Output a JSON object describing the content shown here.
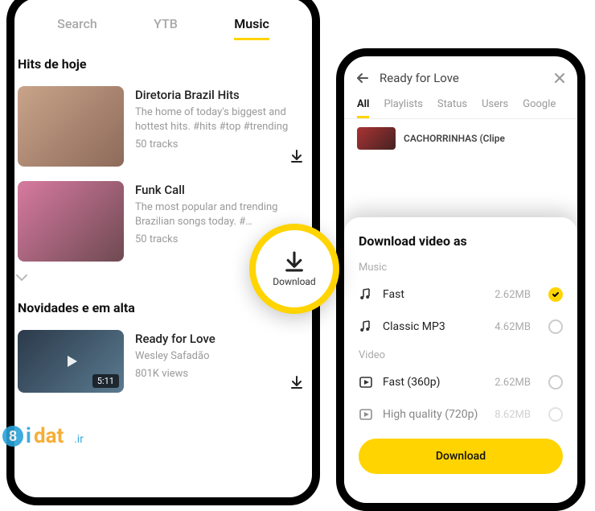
{
  "left": {
    "tabs": [
      "Search",
      "YTB",
      "Music"
    ],
    "activeTabIndex": 2,
    "sections": {
      "hits": {
        "title": "Hits de hoje",
        "items": [
          {
            "title": "Diretoria Brazil Hits",
            "subtitle": "The home of today's biggest and hottest hits. #hits #top #trending",
            "tracks": "50 tracks"
          },
          {
            "title": "Funk Call",
            "subtitle": "The most popular and trending Brazilian songs today. #…",
            "tracks": "50 tracks"
          }
        ]
      },
      "novidades": {
        "title": "Novidades e em alta",
        "items": [
          {
            "title": "Ready for Love",
            "artist": "Wesley Safadão",
            "views": "801K views",
            "duration": "5:11"
          }
        ]
      }
    }
  },
  "floating": {
    "label": "Download"
  },
  "right": {
    "header": {
      "title": "Ready for Love"
    },
    "tabs": [
      "All",
      "Playlists",
      "Status",
      "Users",
      "Google"
    ],
    "activeTabIndex": 0,
    "peekTitle": "CACHORRINHAS (Clipe",
    "sheet": {
      "title": "Download video as",
      "groups": [
        {
          "label": "Music",
          "options": [
            {
              "icon": "music-note-icon",
              "label": "Fast",
              "size": "2.62MB",
              "selected": true
            },
            {
              "icon": "music-note-icon",
              "label": "Classic MP3",
              "size": "4.62MB",
              "selected": false
            }
          ]
        },
        {
          "label": "Video",
          "options": [
            {
              "icon": "video-play-icon",
              "label": "Fast (360p)",
              "size": "2.62MB",
              "selected": false
            },
            {
              "icon": "video-play-icon",
              "label": "High quality (720p)",
              "size": "8.62MB",
              "selected": false
            }
          ]
        }
      ],
      "button": "Download"
    }
  },
  "watermark": {
    "text": "idat.ir"
  }
}
